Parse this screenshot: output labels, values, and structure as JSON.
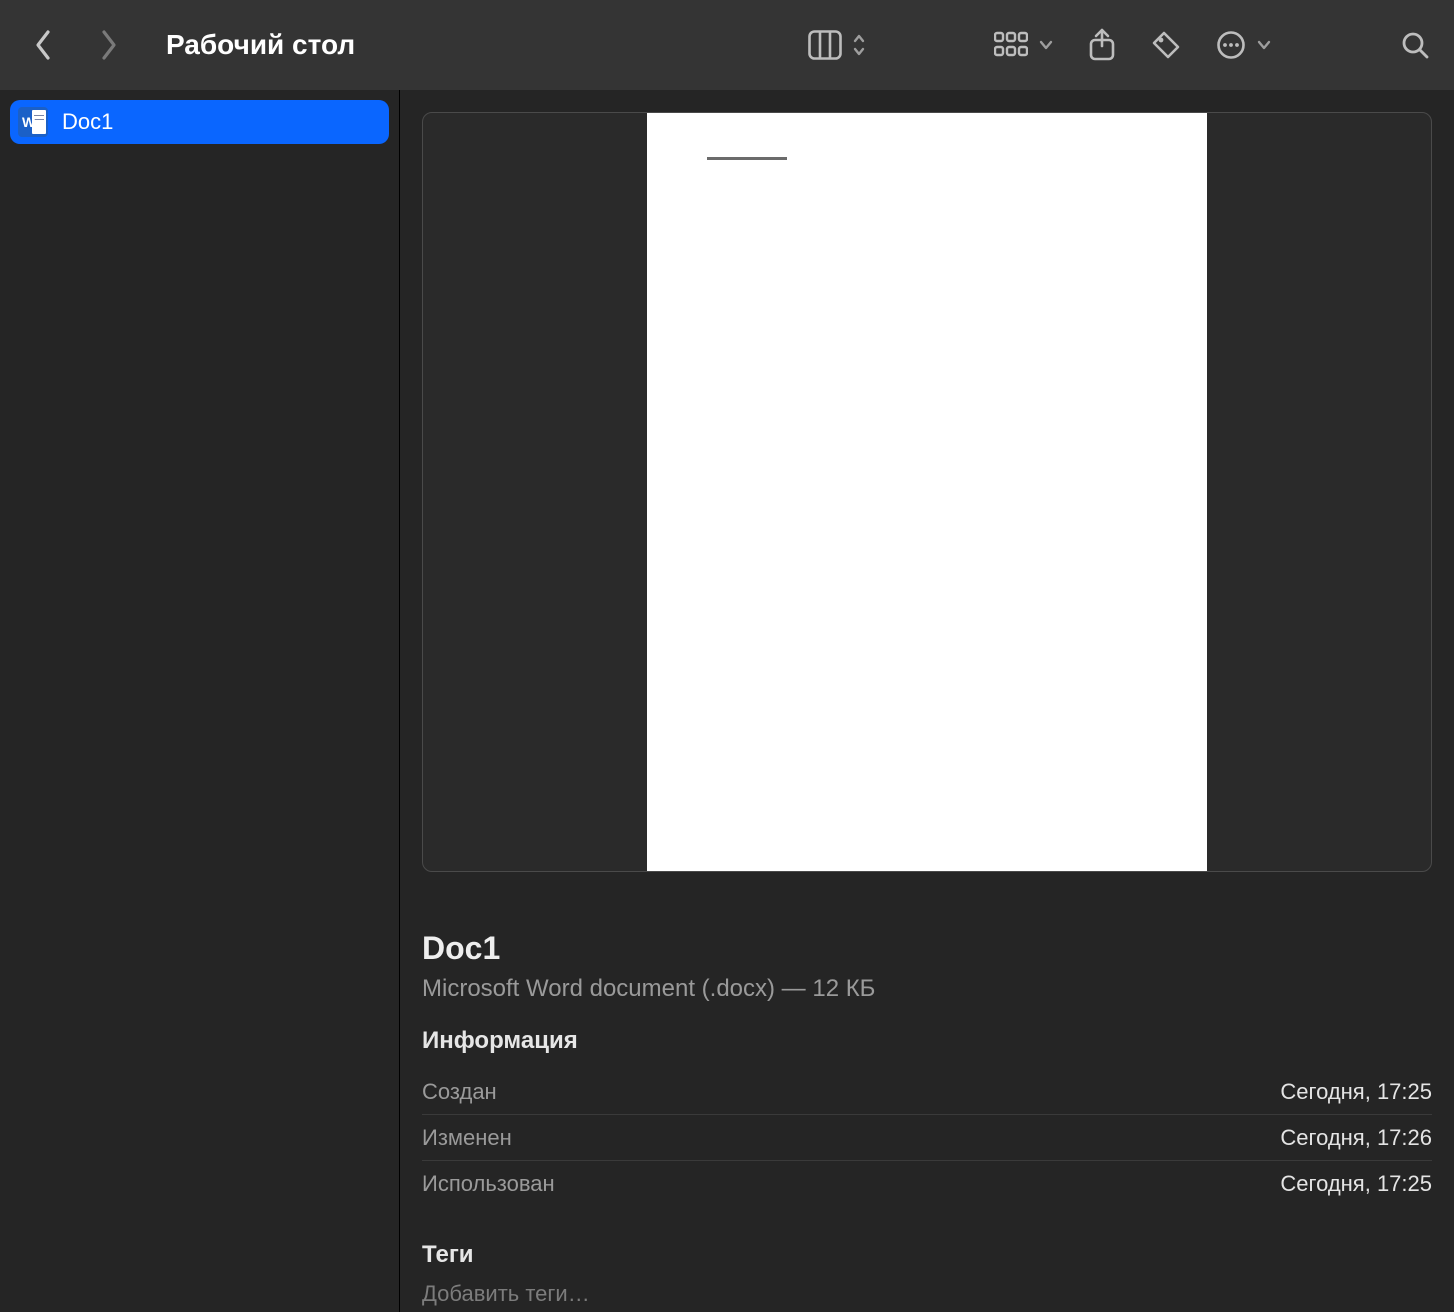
{
  "toolbar": {
    "title": "Рабочий стол"
  },
  "sidebar": {
    "items": [
      {
        "name": "Doc1",
        "selected": true
      }
    ]
  },
  "preview": {
    "title": "Doc1",
    "subtitle": "Microsoft Word document (.docx) — 12 КБ",
    "info_heading": "Информация",
    "info": [
      {
        "label": "Создан",
        "value": "Сегодня, 17:25"
      },
      {
        "label": "Изменен",
        "value": "Сегодня, 17:26"
      },
      {
        "label": "Использован",
        "value": "Сегодня, 17:25"
      }
    ],
    "tags_heading": "Теги",
    "tags_placeholder": "Добавить теги…"
  }
}
